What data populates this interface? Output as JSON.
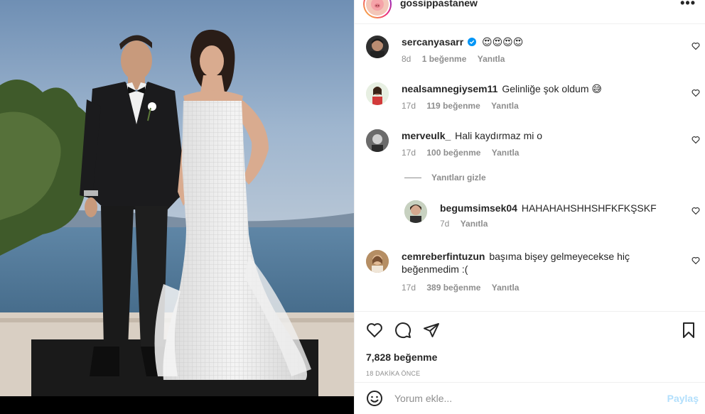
{
  "post": {
    "username": "gossippastanew",
    "more_label": "•••"
  },
  "comments": [
    {
      "username": "sercanyasarr",
      "text": "",
      "emojis": "😍😍😍😍",
      "verified": true,
      "age": "8d",
      "likes": "1 beğenme",
      "reply": "Yanıtla"
    },
    {
      "username": "nealsamnegiysem11",
      "text": "Gelinliğe şok oldum 😅",
      "age": "17d",
      "likes": "119 beğenme",
      "reply": "Yanıtla"
    },
    {
      "username": "merveulk_",
      "text": "Hali kaydırmaz mi o",
      "age": "17d",
      "likes": "100 beğenme",
      "reply": "Yanıtla"
    },
    {
      "username": "begumsimsek04",
      "text": "HAHAHAHSHHSHFKFKŞSKF",
      "age": "7d",
      "reply": "Yanıtla"
    },
    {
      "username": "cemreberfintuzun",
      "text_line1": "başıma bişey gelmeyecekse hiç",
      "text_line2": "beğenmedim :(",
      "age": "17d",
      "likes": "389 beğenme",
      "reply": "Yanıtla"
    }
  ],
  "hide_replies_label": "Yanıtları gizle",
  "actions": {
    "likes_count": "7,828 beğenme",
    "posted_time": "18 DAKİKA ÖNCE"
  },
  "composer": {
    "placeholder": "Yorum ekle...",
    "post_label": "Paylaş"
  },
  "icons": [
    "heart-icon",
    "comment-icon",
    "share-icon",
    "bookmark-icon",
    "emoji-icon",
    "more-icon",
    "verified-icon"
  ],
  "colors": {
    "accent_disabled": "#b2dffc",
    "muted": "#8e8e8e",
    "text": "#262626",
    "verified": "#0095f6"
  }
}
